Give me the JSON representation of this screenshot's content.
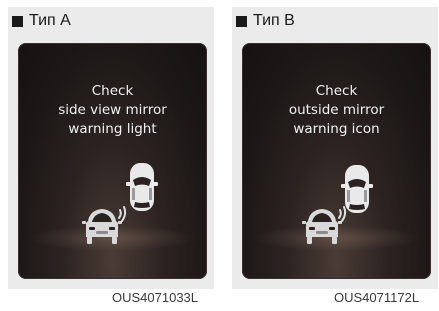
{
  "panels": [
    {
      "type_label": "Тип A",
      "message_lines": [
        "Check",
        "side view mirror",
        "warning light"
      ],
      "image_code": "OUS4071033L"
    },
    {
      "type_label": "Тип B",
      "message_lines": [
        "Check",
        "outside mirror",
        "warning icon"
      ],
      "image_code": "OUS4071172L"
    }
  ],
  "colors": {
    "screen_background": "#1d1817",
    "text": "#f2f2f2",
    "panel_background": "#ebebeb"
  },
  "icons": [
    "car-top-view-icon",
    "approaching-car-icon",
    "signal-waves-icon"
  ]
}
